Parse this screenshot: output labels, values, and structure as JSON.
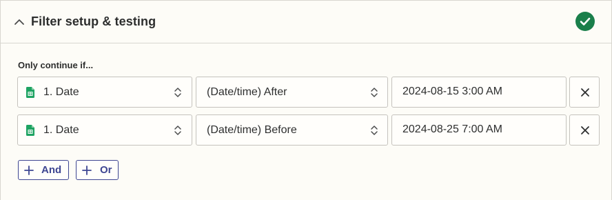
{
  "section": {
    "title": "Filter setup & testing",
    "status": "complete"
  },
  "filter": {
    "condition_label": "Only continue if...",
    "rules": [
      {
        "field": "1. Date",
        "operator": "(Date/time) After",
        "value": "2024-08-15 3:00 AM"
      },
      {
        "field": "1. Date",
        "operator": "(Date/time) Before",
        "value": "2024-08-25 7:00 AM"
      }
    ],
    "and_label": "And",
    "or_label": "Or"
  },
  "colors": {
    "check_green": "#1a7f4b",
    "sheets_green": "#1ea362",
    "button_blue": "#3d4592"
  },
  "icons": {
    "collapse": "chevron-up-icon",
    "status": "check-circle-icon",
    "field_app": "google-sheets-icon",
    "select": "up-down-arrows-icon",
    "remove": "close-icon",
    "add": "plus-icon"
  }
}
